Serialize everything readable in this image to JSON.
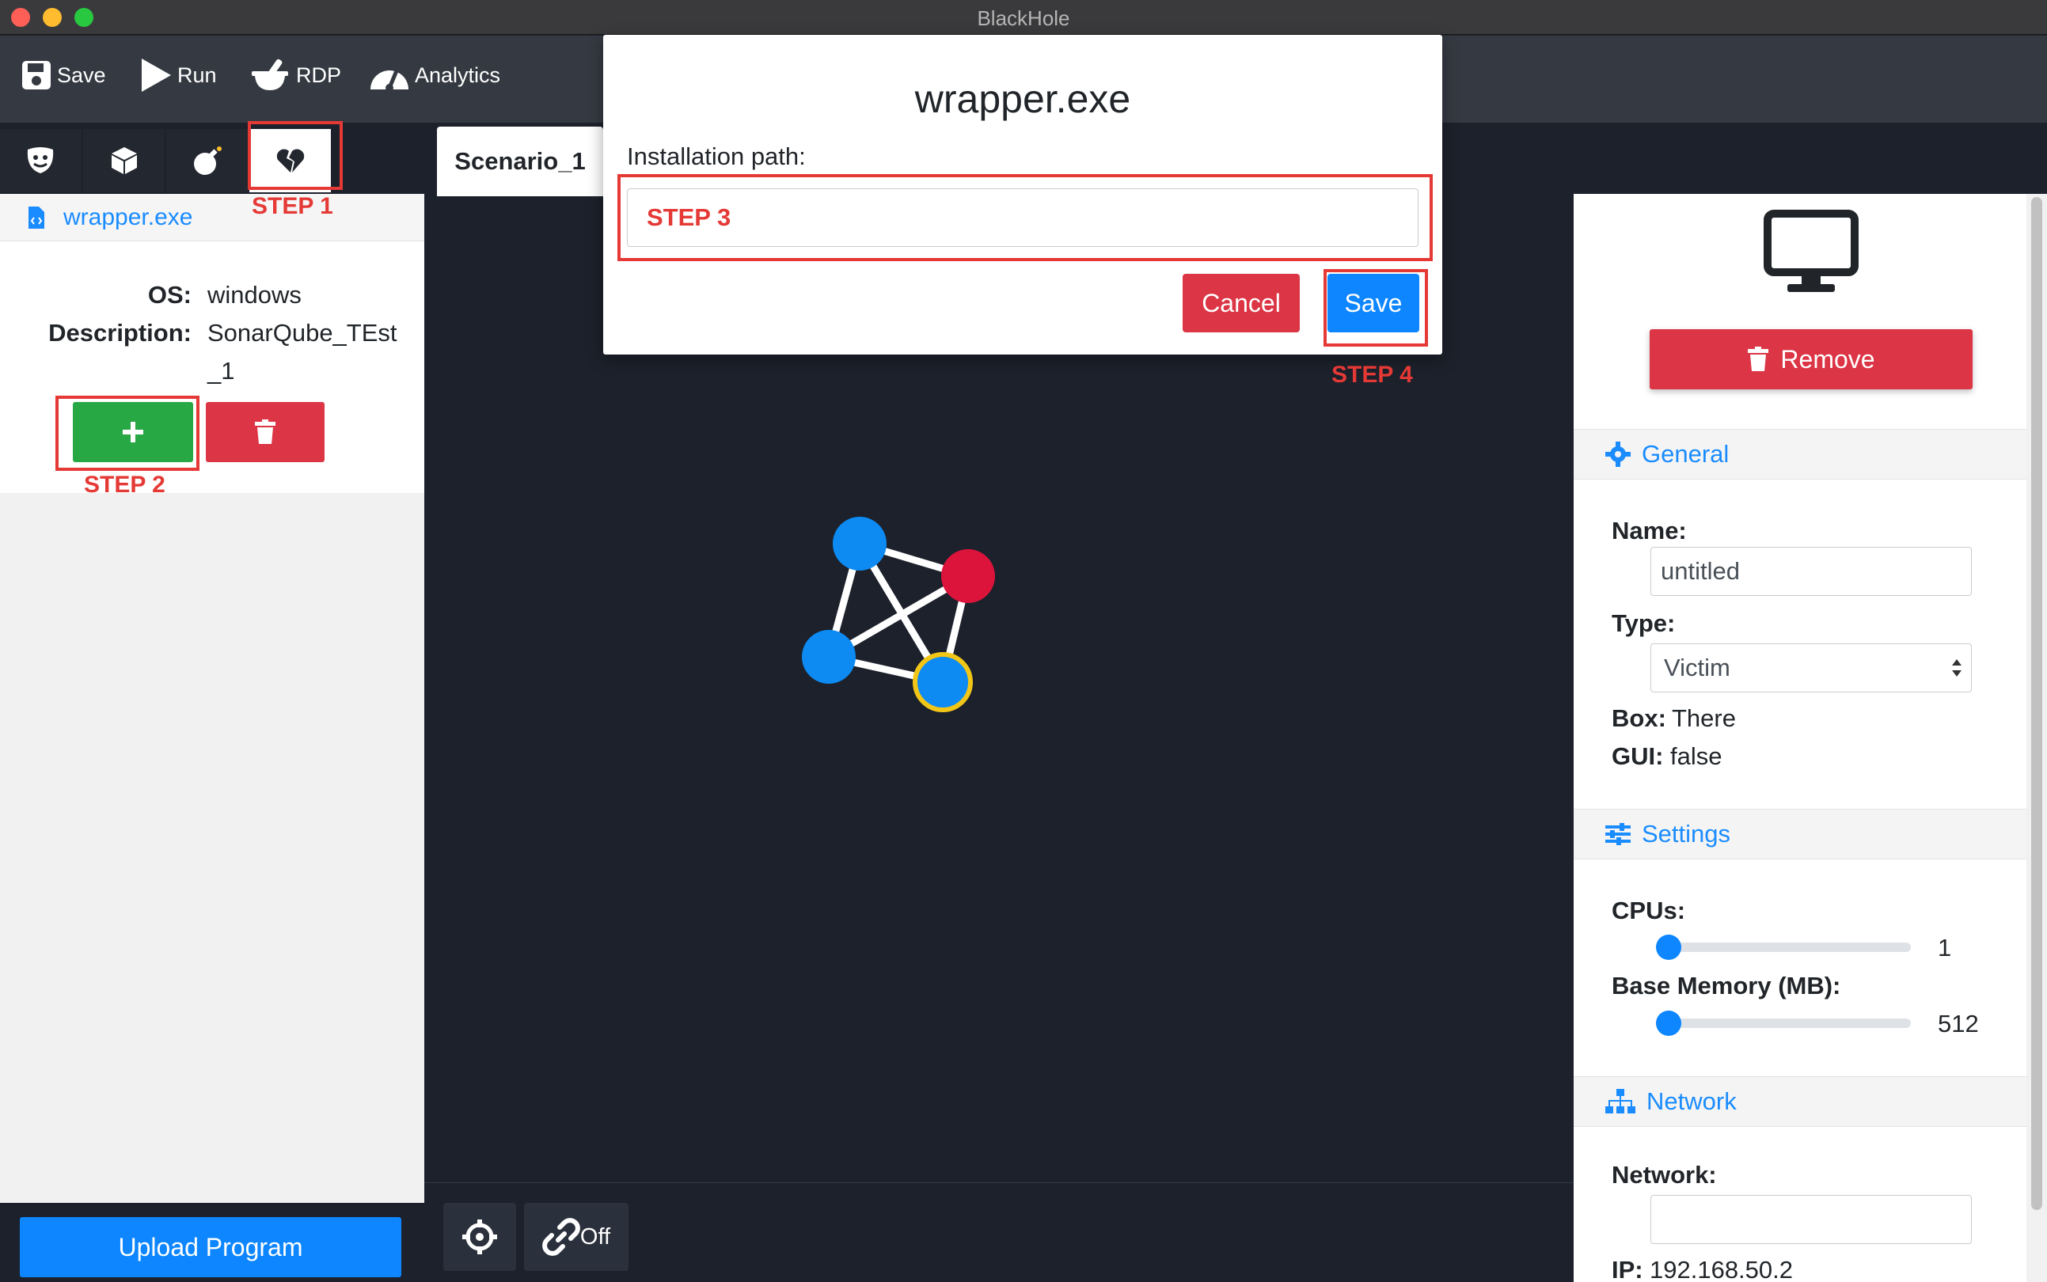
{
  "window": {
    "title": "BlackHole"
  },
  "toolbar": {
    "save": "Save",
    "run": "Run",
    "rdp": "RDP",
    "analytics": "Analytics"
  },
  "left_tabs": [
    {
      "icon": "masks-icon"
    },
    {
      "icon": "box-icon"
    },
    {
      "icon": "bomb-icon"
    },
    {
      "icon": "heart-broken-icon",
      "active": true
    }
  ],
  "program": {
    "name": "wrapper.exe",
    "os_label": "OS:",
    "os": "windows",
    "description_label": "Description:",
    "description_line1": "SonarQube_TEst",
    "description_line2": "_1"
  },
  "upload_button": "Upload Program",
  "scenario_tab": "Scenario_1",
  "canvas_controls": {
    "link_label": "Off"
  },
  "graph": {
    "nodes": [
      {
        "color": "#0d8bf2"
      },
      {
        "color": "#dc143c"
      },
      {
        "color": "#0d8bf2"
      },
      {
        "color": "#0d8bf2",
        "ring": "#f2c617"
      }
    ]
  },
  "modal": {
    "title": "wrapper.exe",
    "label": "Installation path:",
    "input_value": "STEP 3",
    "cancel": "Cancel",
    "save": "Save"
  },
  "steps": {
    "step1": "STEP 1",
    "step2": "STEP 2",
    "step4": "STEP 4"
  },
  "right_panel": {
    "remove": "Remove",
    "general_header": "General",
    "name_label": "Name:",
    "name_value": "untitled",
    "type_label": "Type:",
    "type_value": "Victim",
    "box_label": "Box:",
    "box_value": "There",
    "gui_label": "GUI:",
    "gui_value": "false",
    "settings_header": "Settings",
    "cpus_label": "CPUs:",
    "cpus_value": "1",
    "memory_label": "Base Memory (MB):",
    "memory_value": "512",
    "network_header": "Network",
    "network_label": "Network:",
    "network_value": "",
    "ip_label": "IP:",
    "ip_value": "192.168.50.2"
  },
  "colors": {
    "accent": "#0d86ff",
    "danger": "#dc3545",
    "success": "#28a745",
    "annotation": "#e53935"
  }
}
